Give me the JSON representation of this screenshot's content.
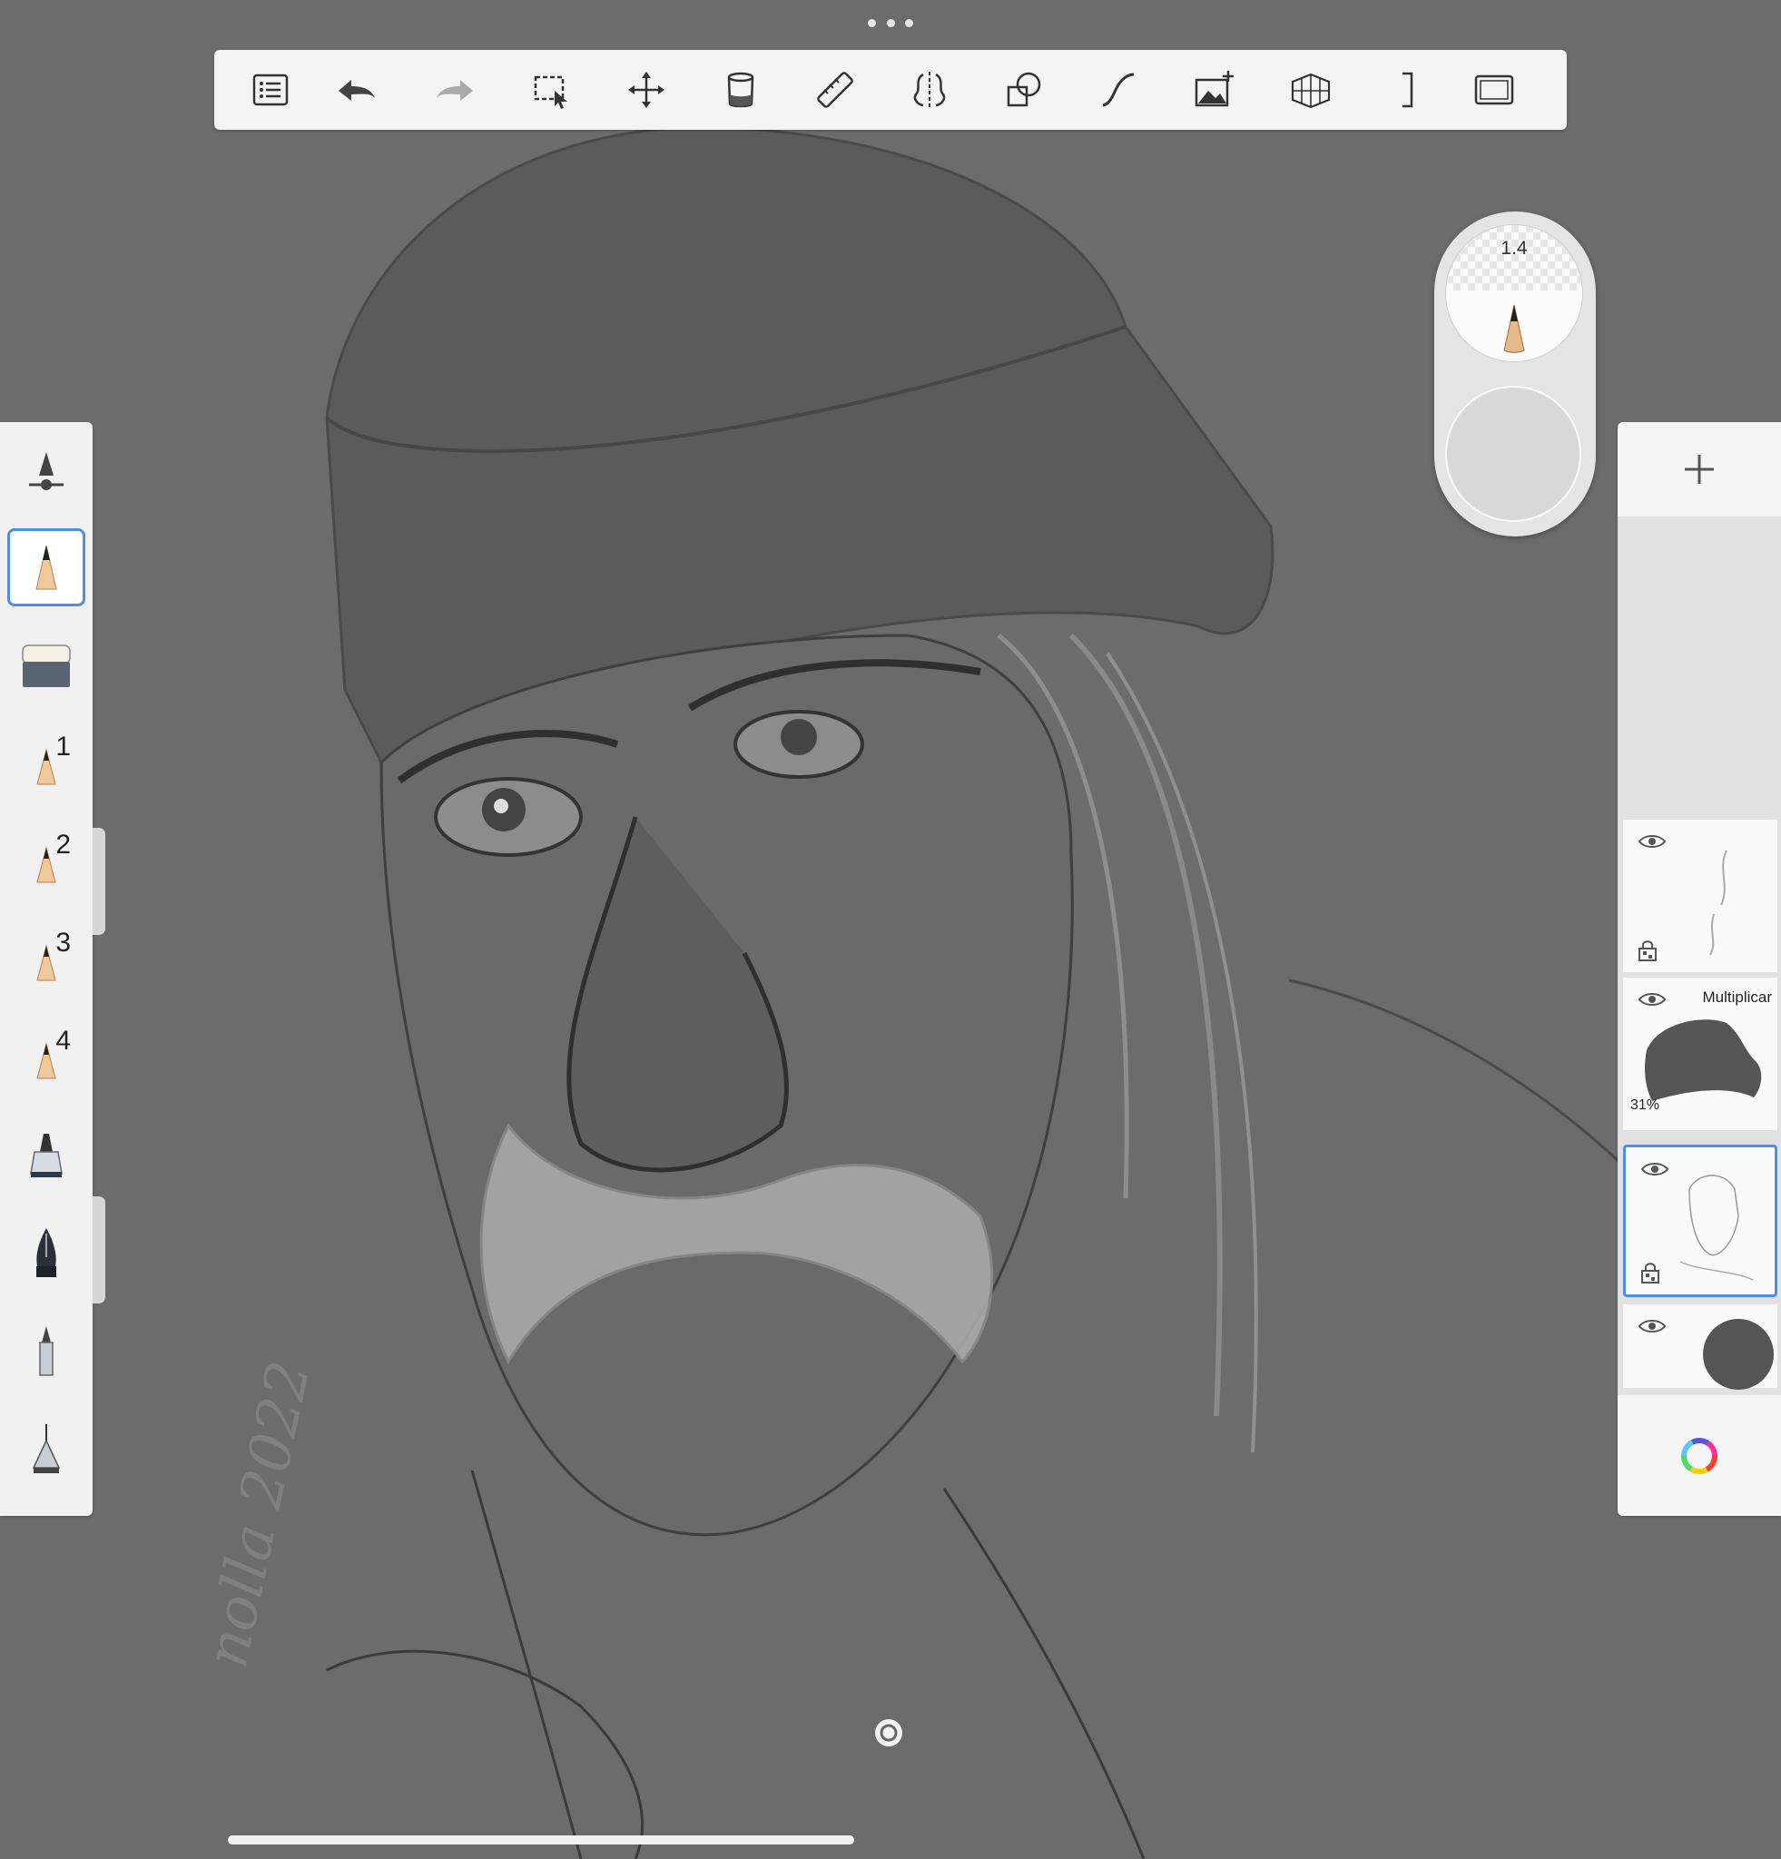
{
  "toolbar": {
    "items": [
      {
        "name": "gallery-list-icon"
      },
      {
        "name": "undo-icon"
      },
      {
        "name": "redo-icon"
      },
      {
        "name": "selection-icon"
      },
      {
        "name": "transform-icon"
      },
      {
        "name": "fill-bucket-icon"
      },
      {
        "name": "ruler-icon"
      },
      {
        "name": "symmetry-icon"
      },
      {
        "name": "shapes-icon"
      },
      {
        "name": "stroke-icon"
      },
      {
        "name": "add-image-icon"
      },
      {
        "name": "perspective-icon"
      },
      {
        "name": "crop-bracket-icon"
      },
      {
        "name": "fullscreen-icon"
      }
    ]
  },
  "brush": {
    "size_label": "1.4"
  },
  "left_tools": [
    {
      "name": "brush-settings-icon",
      "label": ""
    },
    {
      "name": "pencil-icon",
      "label": ""
    },
    {
      "name": "eraser-icon",
      "label": ""
    },
    {
      "name": "pencil-preset-1-icon",
      "label": "1"
    },
    {
      "name": "pencil-preset-2-icon",
      "label": "2"
    },
    {
      "name": "pencil-preset-3-icon",
      "label": "3"
    },
    {
      "name": "pencil-preset-4-icon",
      "label": "4"
    },
    {
      "name": "marker-icon",
      "label": ""
    },
    {
      "name": "fountain-pen-icon",
      "label": ""
    },
    {
      "name": "ballpoint-pen-icon",
      "label": ""
    },
    {
      "name": "fineliner-icon",
      "label": ""
    }
  ],
  "layers": {
    "items": [
      {
        "mode": "",
        "opacity": ""
      },
      {
        "mode": "Multiplicar",
        "opacity": "31%"
      },
      {
        "mode": "",
        "opacity": ""
      },
      {
        "mode": "",
        "opacity": ""
      }
    ],
    "background_color": "#555555"
  },
  "colors": {
    "selection": "#4c8ee8",
    "canvas_bg": "#6c6c6c"
  }
}
